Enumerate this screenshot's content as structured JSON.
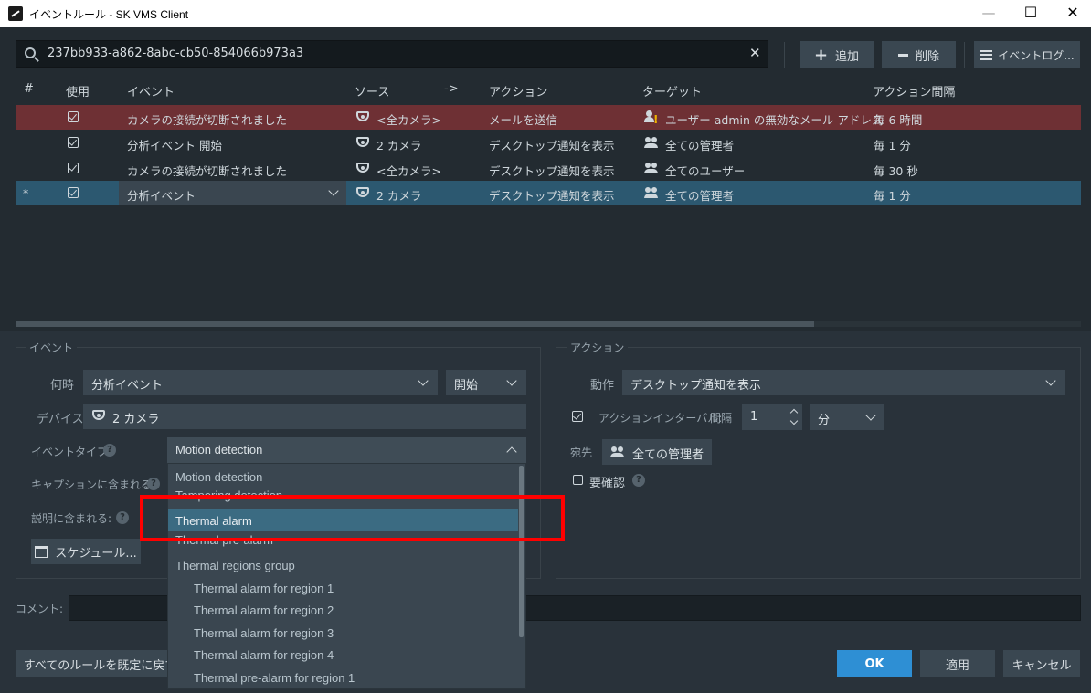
{
  "window": {
    "title": "イベントルール - SK VMS Client",
    "minimize": "—",
    "maximize": "☐",
    "close": "✕"
  },
  "search": {
    "value": "237bb933-a862-8abc-cb50-854066b973a3"
  },
  "toolbar": {
    "add": "追加",
    "delete": "削除",
    "event_log": "イベントログ..."
  },
  "table": {
    "headers": {
      "num": "#",
      "use": "使用",
      "event": "イベント",
      "source": "ソース",
      "arrow": "->",
      "action": "アクション",
      "target": "ターゲット",
      "interval": "アクション間隔"
    },
    "rows": [
      {
        "num": "",
        "event": "カメラの接続が切断されました",
        "source": "<全カメラ>",
        "action": "メールを送信",
        "target": "ユーザー admin の無効なメール アドレス",
        "interval": "毎 6 時間"
      },
      {
        "num": "",
        "event": "分析イベント 開始",
        "source": "2 カメラ",
        "action": "デスクトップ通知を表示",
        "target": "全ての管理者",
        "interval": "毎 1 分"
      },
      {
        "num": "",
        "event": "カメラの接続が切断されました",
        "source": "<全カメラ>",
        "action": "デスクトップ通知を表示",
        "target": "全てのユーザー",
        "interval": "毎 30 秒"
      },
      {
        "num": "*",
        "event": "分析イベント",
        "source": "2 カメラ",
        "action": "デスクトップ通知を表示",
        "target": "全ての管理者",
        "interval": "毎 1 分"
      }
    ]
  },
  "event_panel": {
    "legend": "イベント",
    "when_label": "何時",
    "when_value": "分析イベント",
    "start_value": "開始",
    "device_label": "デバイス",
    "device_value": "2 カメラ",
    "event_type_label": "イベントタイプ:",
    "event_type_value": "Motion detection",
    "caption_label": "キャプションに含まれる:",
    "description_label": "説明に含まれる:",
    "schedule_button": "スケジュール..."
  },
  "action_panel": {
    "legend": "アクション",
    "action_label": "動作",
    "action_value": "デスクトップ通知を表示",
    "interval_label": "アクションインターバル:",
    "interval_sub": "間隔",
    "interval_value": "1",
    "interval_unit": "分",
    "to_label": "宛先",
    "to_value": "全ての管理者",
    "confirm_label": "要確認"
  },
  "comment_label": "コメント:",
  "dropdown": {
    "items": [
      "Motion detection",
      "Tampering detection",
      "Thermal alarm",
      "Thermal pre-alarm",
      "Thermal regions group",
      "Thermal alarm for region 1",
      "Thermal alarm for region 2",
      "Thermal alarm for region 3",
      "Thermal alarm for region 4",
      "Thermal pre-alarm for region 1"
    ],
    "selected_index": 2
  },
  "footer": {
    "reset": "すべてのルールを既定に戻す",
    "ok": "OK",
    "apply": "適用",
    "cancel": "キャンセル"
  },
  "colors": {
    "error_row": "#6e3034",
    "selected_row": "#2c5870",
    "ok_button": "#2e8fd4",
    "highlight_box": "#ff0000",
    "dropdown_selected": "#3b6b82"
  }
}
